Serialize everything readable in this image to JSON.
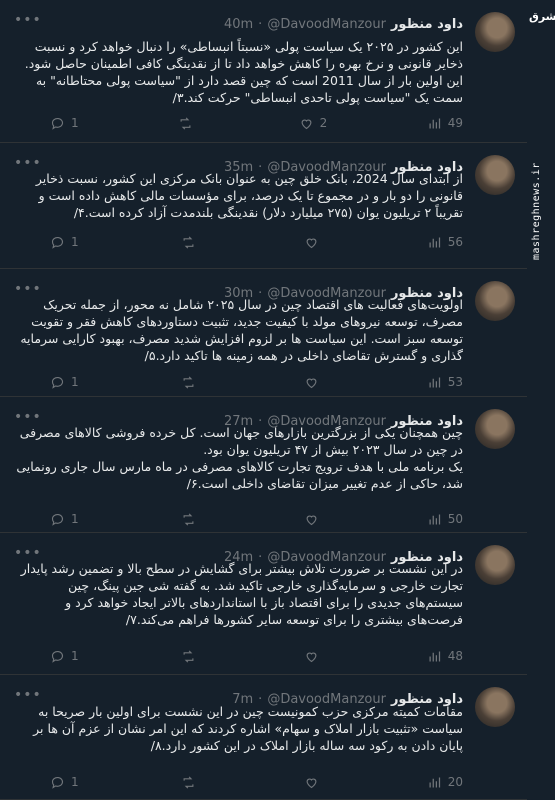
{
  "brand": {
    "logo_text": "مشرق",
    "side_url": "mashreghnews.ir"
  },
  "tweets": [
    {
      "name": "داود منظور",
      "handle": "@DavoodManzour",
      "time": "40m",
      "text": "این کشور در ۲۰۲۵ یک سیاست پولی «نسبتاً انبساطی» را دنبال خواهد کرد و نسبت ذخایر قانونی و نرخ بهره را کاهش خواهد داد تا از نقدینگی کافی اطمینان حاصل شود. این اولین بار از سال 2011 است که چین قصد دارد از \"سیاست پولی محتاطانه\" به سمت یک \"سیاست پولی تاحدی انبساطی\" حرکت کند.۳/",
      "replies": "1",
      "retweets": "",
      "likes": "2",
      "views": "49"
    },
    {
      "name": "داود منظور",
      "handle": "@DavoodManzour",
      "time": "35m",
      "text": "از ابتدای سال 2024، بانک خلق چین به عنوان بانک مرکزی این کشور، نسبت ذخایر قانونی را دو بار و در مجموع تا یک درصد، برای مؤسسات مالی کاهش داده است و تقریباً ۲ تریلیون یوان (۲۷۵ میلیارد دلار) نقدینگی بلندمدت آزاد کرده است.۴/",
      "replies": "1",
      "retweets": "",
      "likes": "",
      "views": "56"
    },
    {
      "name": "داود منظور",
      "handle": "@DavoodManzour",
      "time": "30m",
      "text": "اولویت‌های فعالیت های اقتصاد چین در سال ۲۰۲۵ شامل نه محور، از جمله تحریک مصرف، توسعه نیروهای مولد با کیفیت جدید، تثبیت دستاوردهای کاهش فقر و تقویت توسعه سبز است. این سیاست ها بر لزوم افزایش شدید مصرف، بهبود کارایی سرمایه گذاری و گسترش تقاضای داخلی در همه زمینه ها تاکید دارد.۵/",
      "replies": "1",
      "retweets": "",
      "likes": "",
      "views": "53"
    },
    {
      "name": "داود منظور",
      "handle": "@DavoodManzour",
      "time": "27m",
      "text": "چین همچنان یکی از بزرگترین بازارهای جهان است. کل خرده فروشی کالاهای مصرفی در چین در سال ۲۰۲۳ بیش از ۴۷ تریلیون یوان بود.\nیک برنامه ملی با هدف ترویج تجارت کالاهای مصرفی در ماه مارس سال جاری رونمایی شد، حاکی از عدم تغییر میزان تقاضای داخلی است.۶/",
      "replies": "1",
      "retweets": "",
      "likes": "",
      "views": "50"
    },
    {
      "name": "داود منظور",
      "handle": "@DavoodManzour",
      "time": "24m",
      "text": "در این نشست بر ضرورت تلاش بیشتر برای گشایش در سطح بالا و تضمین رشد پایدار تجارت خارجی و سرمایه‌گذاری خارجی تاکید شد. به گفته شی جین پینگ، چین سیستم‌های جدیدی را برای اقتصاد باز با استانداردهای بالاتر ایجاد خواهد کرد و فرصت‌های بیشتری را برای توسعه سایر کشورها فراهم می‌کند.۷/",
      "replies": "1",
      "retweets": "",
      "likes": "",
      "views": "48"
    },
    {
      "name": "داود منظور",
      "handle": "@DavoodManzour",
      "time": "7m",
      "text": "مقامات کمیته مرکزی حزب کمونیست چین در این نشست برای اولین بار صریحا به سیاست «تثبیت بازار املاک و سهام» اشاره کردند که این امر نشان از عزم آن ها بر پایان دادن به رکود سه ساله بازار املاک در این کشور دارد.۸/",
      "replies": "1",
      "retweets": "",
      "likes": "",
      "views": "20"
    }
  ],
  "icons": {
    "reply": "speech-bubble-icon",
    "retweet": "retweet-arrows-icon",
    "like": "heart-icon",
    "views": "bar-chart-icon",
    "more": "ellipsis-icon"
  },
  "colors": {
    "background": "#15202b",
    "text": "#e7e9ea",
    "muted": "#71767b",
    "divider": "#2f3336"
  }
}
